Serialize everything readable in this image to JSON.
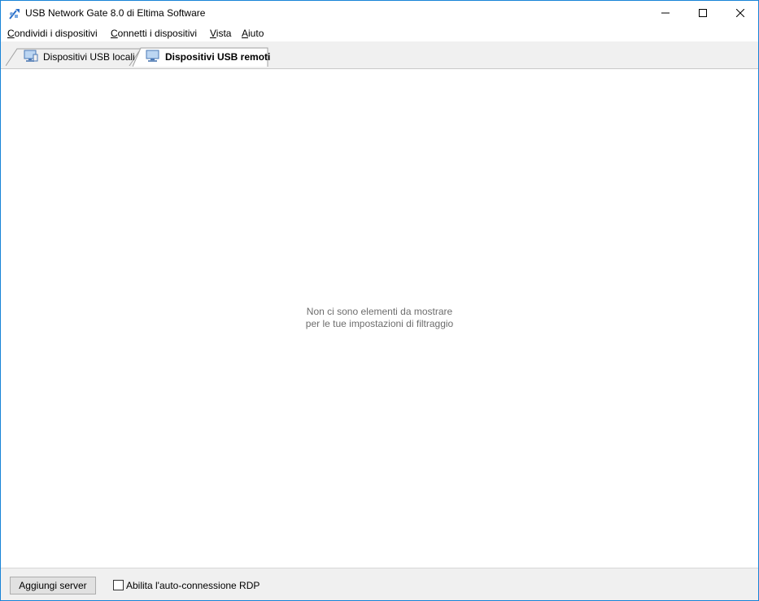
{
  "window": {
    "title": "USB Network Gate 8.0 di Eltima Software",
    "accent": "#1883d7"
  },
  "menu": {
    "items": [
      {
        "label": "Condividi i dispositivi",
        "mnemonic": "C"
      },
      {
        "label": "Connetti i dispositivi",
        "mnemonic": "C"
      },
      {
        "label": "Vista",
        "mnemonic": "V"
      },
      {
        "label": "Aiuto",
        "mnemonic": "A"
      }
    ]
  },
  "tabs": [
    {
      "label": "Dispositivi USB locali",
      "icon": "local-computer-icon",
      "active": false
    },
    {
      "label": "Dispositivi USB remoti",
      "icon": "remote-computer-icon",
      "active": true
    }
  ],
  "content": {
    "empty_line1": "Non ci sono elementi da mostrare",
    "empty_line2": "per le tue impostazioni di filtraggio"
  },
  "bottom": {
    "add_server_label": "Aggiungi server",
    "rdp_label": "Abilita l'auto-connessione RDP",
    "rdp_checked": false
  }
}
